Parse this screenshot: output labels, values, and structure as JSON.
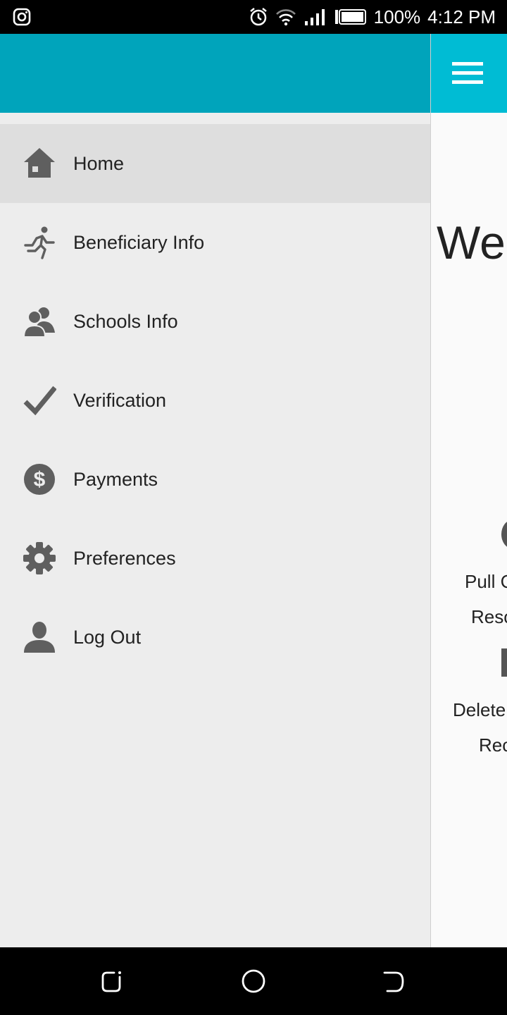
{
  "status_bar": {
    "left_icon": "instagram-icon",
    "icons": [
      "alarm-icon",
      "wifi-icon",
      "signal-icon",
      "battery-icon"
    ],
    "battery": "100%",
    "time": "4:12 PM"
  },
  "app_bar": {
    "color": "#00bcd4",
    "drawer_header_color": "#00a4bb",
    "menu_icon": "hamburger-menu-icon"
  },
  "background": {
    "welcome_text": "Wel",
    "line1": "Pull C",
    "line2": "Reso",
    "line3": "Delete",
    "line4": "Rec"
  },
  "drawer": {
    "items": [
      {
        "label": "Home",
        "icon": "home-icon",
        "active": true
      },
      {
        "label": "Beneficiary Info",
        "icon": "running-person-icon",
        "active": false
      },
      {
        "label": "Schools Info",
        "icon": "users-icon",
        "active": false
      },
      {
        "label": "Verification",
        "icon": "checkmark-icon",
        "active": false
      },
      {
        "label": "Payments",
        "icon": "dollar-icon",
        "active": false
      },
      {
        "label": "Preferences",
        "icon": "gear-icon",
        "active": false
      },
      {
        "label": "Log Out",
        "icon": "user-icon",
        "active": false
      }
    ]
  },
  "nav_bar": {
    "buttons": [
      "recent-apps-icon",
      "home-circle-icon",
      "back-icon"
    ]
  }
}
